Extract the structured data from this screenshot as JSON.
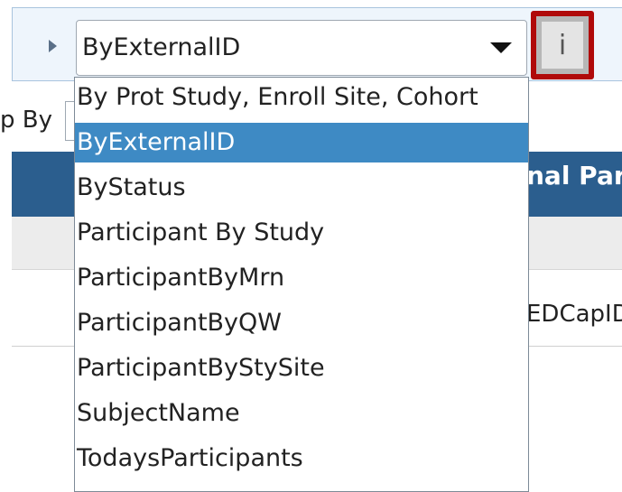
{
  "selector": {
    "current_value": "ByExternalID",
    "info_button_label": "i",
    "options": [
      {
        "label": "By Prot Study, Enroll Site, Cohort",
        "selected": false
      },
      {
        "label": "ByExternalID",
        "selected": true
      },
      {
        "label": "ByStatus",
        "selected": false
      },
      {
        "label": "Participant By Study",
        "selected": false
      },
      {
        "label": "ParticipantByMrn",
        "selected": false
      },
      {
        "label": "ParticipantByQW",
        "selected": false
      },
      {
        "label": "ParticipantByStySite",
        "selected": false
      },
      {
        "label": "SubjectName",
        "selected": false
      },
      {
        "label": "TodaysParticipants",
        "selected": false
      }
    ]
  },
  "background": {
    "groupby_label": "p By",
    "header_partial": "nal Part",
    "cell_partial": "EDCapID"
  },
  "colors": {
    "header": "#2b5e8e",
    "selected_option": "#3e8ac4",
    "highlight": "#b00a0a"
  }
}
